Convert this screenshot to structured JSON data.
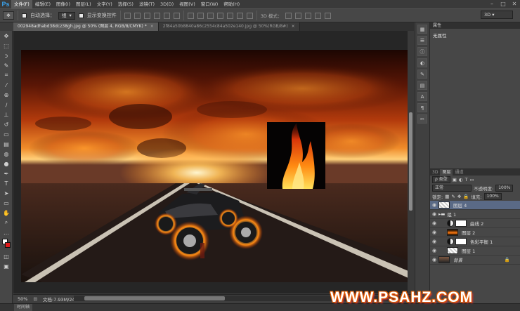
{
  "app": {
    "logo": "Ps"
  },
  "menu": [
    "文件(F)",
    "编辑(E)",
    "图像(I)",
    "图层(L)",
    "文字(Y)",
    "选择(S)",
    "滤镜(T)",
    "3D(D)",
    "视图(V)",
    "窗口(W)",
    "帮助(H)"
  ],
  "window_controls": [
    "–",
    "□",
    "✕"
  ],
  "options": {
    "auto_select": "自动选择：",
    "auto_select_target": "组",
    "show_transform": "显示变换控件",
    "mode_3d": "3D 模式：",
    "workspace": "3D"
  },
  "tabs": [
    {
      "label": "002948adhabd38dcz38gh.jpg @ 50% (图层 4, RGB/8/CMYK) *",
      "close": "×",
      "active": true
    },
    {
      "label": "2f84a50b8840a86c2554c84a502e140.jpg @ 50%(RGB/8#)",
      "close": "×",
      "active": false
    }
  ],
  "status": {
    "zoom": "50%",
    "doc": "文档:7.93M/24.6M"
  },
  "timeline": {
    "label": "时间轴"
  },
  "properties": {
    "header": "属性",
    "value": "无属性"
  },
  "layers_panel": {
    "tabs": [
      "3D",
      "图层",
      "通道"
    ],
    "kind": "ρ 类型",
    "blend": "正常",
    "opacity_label": "不透明度:",
    "opacity": "100%",
    "lock_label": "锁定:",
    "fill_label": "填充:",
    "fill": "100%",
    "layers": [
      {
        "name": "图层 4",
        "thumb": "check",
        "selected": true
      },
      {
        "name": "组 1",
        "group": true
      },
      {
        "name": "曲线 2",
        "adjust": true
      },
      {
        "name": "图层 2",
        "thumb": "fire"
      },
      {
        "name": "色彩平衡 1",
        "adjust": true
      },
      {
        "name": "图层 1",
        "thumb": "check"
      },
      {
        "name": "背景",
        "thumb": "dark",
        "locked": true,
        "lock": "🔒"
      }
    ]
  },
  "watermark": "WWW.PSAHZ.COM"
}
